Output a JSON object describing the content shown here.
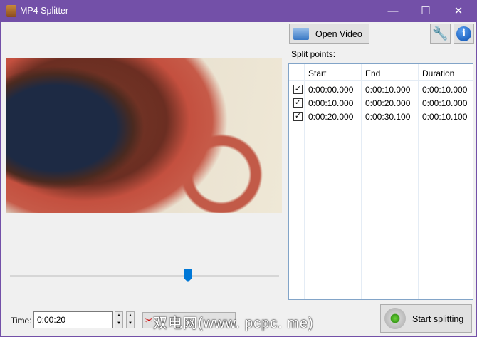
{
  "window": {
    "title": "MP4 Splitter",
    "minimize": "—",
    "maximize": "☐",
    "close": "✕"
  },
  "toolbar": {
    "open_video": "Open Video",
    "settings_icon": "wrench-icon",
    "info_icon": "info-icon"
  },
  "split_points": {
    "label": "Split points:",
    "columns": [
      "Start",
      "End",
      "Duration"
    ],
    "rows": [
      {
        "checked": true,
        "start": "0:00:00.000",
        "end": "0:00:10.000",
        "duration": "0:00:10.000"
      },
      {
        "checked": true,
        "start": "0:00:10.000",
        "end": "0:00:20.000",
        "duration": "0:00:10.000"
      },
      {
        "checked": true,
        "start": "0:00:20.000",
        "end": "0:00:30.100",
        "duration": "0:00:10.100"
      }
    ]
  },
  "player": {
    "position_percent": 66
  },
  "time": {
    "label": "Time:",
    "value": "0:00:20"
  },
  "actions": {
    "start_splitting": "Start splitting"
  },
  "watermark": "双电网(www. pcpc. me)"
}
